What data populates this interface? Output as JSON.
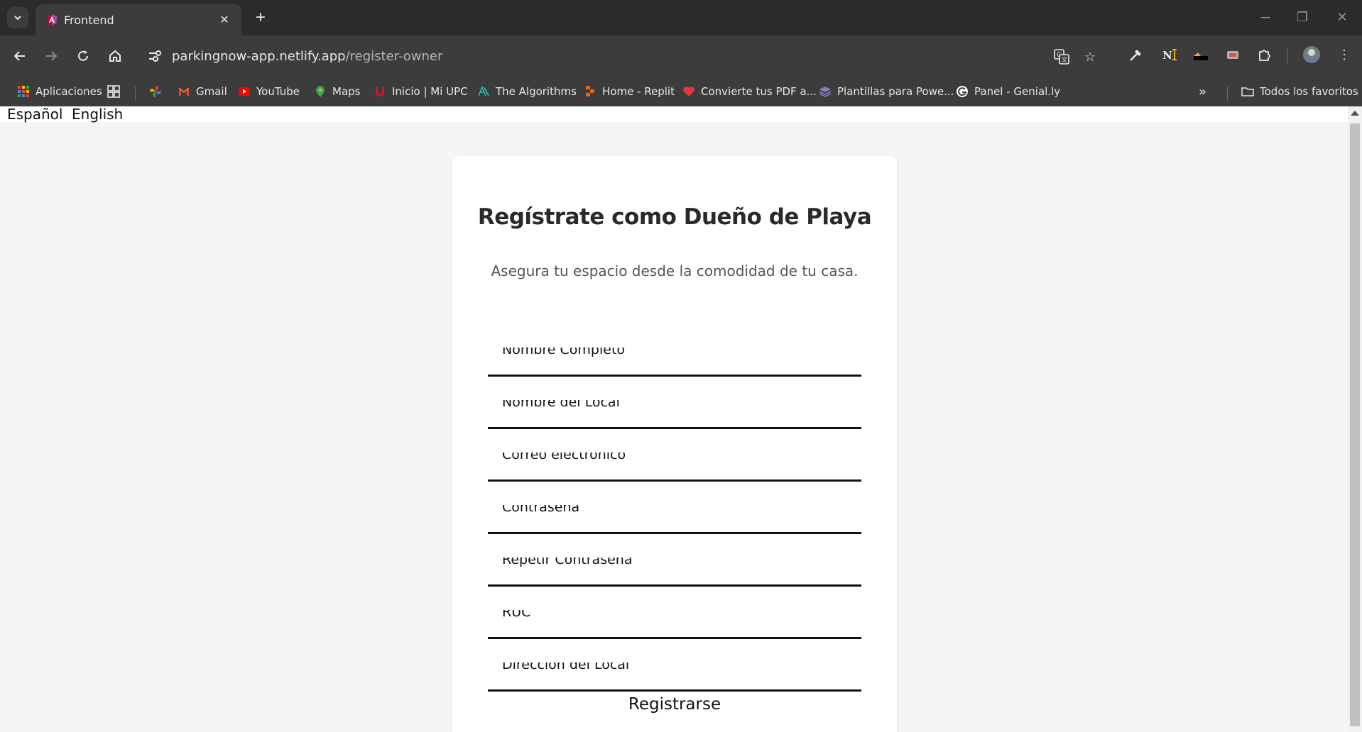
{
  "browser": {
    "tab": {
      "title": "Frontend"
    },
    "url": {
      "host": "parkingnow-app.netlify.app",
      "path": "/register-owner"
    },
    "bookmarks": [
      {
        "label": "Aplicaciones",
        "icon": "apps-grid-icon"
      },
      {
        "label": "",
        "icon": "tab-groups-icon"
      },
      {
        "label": "",
        "icon": "photos-pinwheel-icon"
      },
      {
        "label": "Gmail",
        "icon": "gmail-icon"
      },
      {
        "label": "YouTube",
        "icon": "youtube-icon"
      },
      {
        "label": "Maps",
        "icon": "maps-icon"
      },
      {
        "label": "Inicio | Mi UPC",
        "icon": "upc-icon"
      },
      {
        "label": "The Algorithms",
        "icon": "algorithms-icon"
      },
      {
        "label": "Home - Replit",
        "icon": "replit-icon"
      },
      {
        "label": "Convierte tus PDF a...",
        "icon": "pdf-heart-icon"
      },
      {
        "label": "Plantillas para Powe...",
        "icon": "layers-icon"
      },
      {
        "label": "Panel - Genial.ly",
        "icon": "genially-icon"
      }
    ],
    "all_bookmarks": "Todos los favoritos",
    "colors": {
      "chrome_dark": "#2b2b2b",
      "chrome_toolbar": "#3c3c3c"
    }
  },
  "page": {
    "language": {
      "es": "Español",
      "en": "English"
    },
    "title": "Regístrate como Dueño de Playa",
    "subtitle": "Asegura tu espacio desde la comodidad de tu casa.",
    "fields": [
      {
        "label": "Nombre Completo",
        "required": "*"
      },
      {
        "label": "Nombre del Local",
        "required": "*"
      },
      {
        "label": "Correo electrónico",
        "required": "*"
      },
      {
        "label": "Contraseña",
        "required": "*"
      },
      {
        "label": "Repetir Contraseña",
        "required": "*"
      },
      {
        "label": "RUC",
        "required": "*"
      },
      {
        "label": "Dirección del Local",
        "required": "*"
      }
    ],
    "submit_label": "Registrarse"
  }
}
